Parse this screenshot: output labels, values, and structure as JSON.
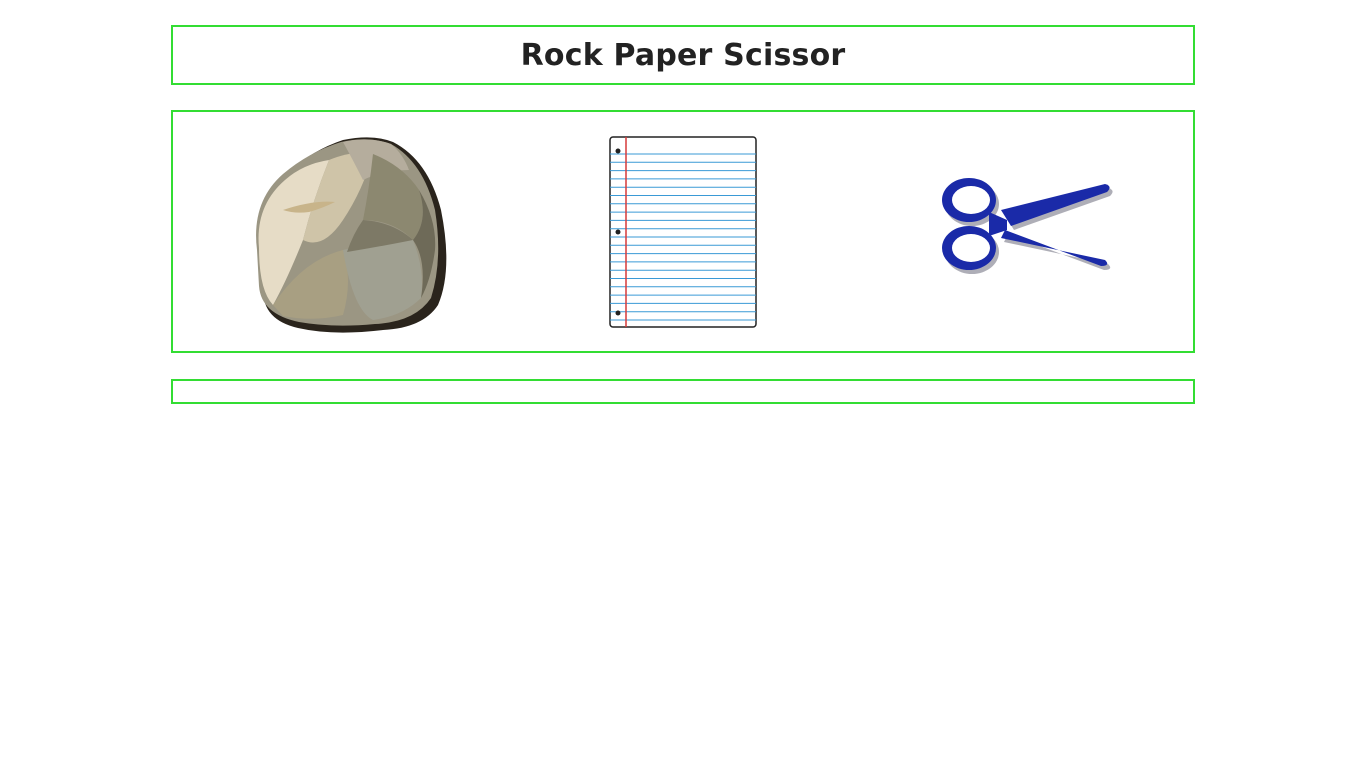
{
  "header": {
    "title": "Rock Paper Scissor"
  },
  "choices": [
    {
      "id": "rock",
      "icon": "rock-icon"
    },
    {
      "id": "paper",
      "icon": "paper-icon"
    },
    {
      "id": "scissors",
      "icon": "scissors-icon"
    }
  ],
  "result": {
    "text": ""
  },
  "colors": {
    "border": "#33dd33",
    "scissors": "#1a2aa8",
    "paper_lines": "#3a9ad6",
    "paper_margin": "#d63a3a"
  }
}
